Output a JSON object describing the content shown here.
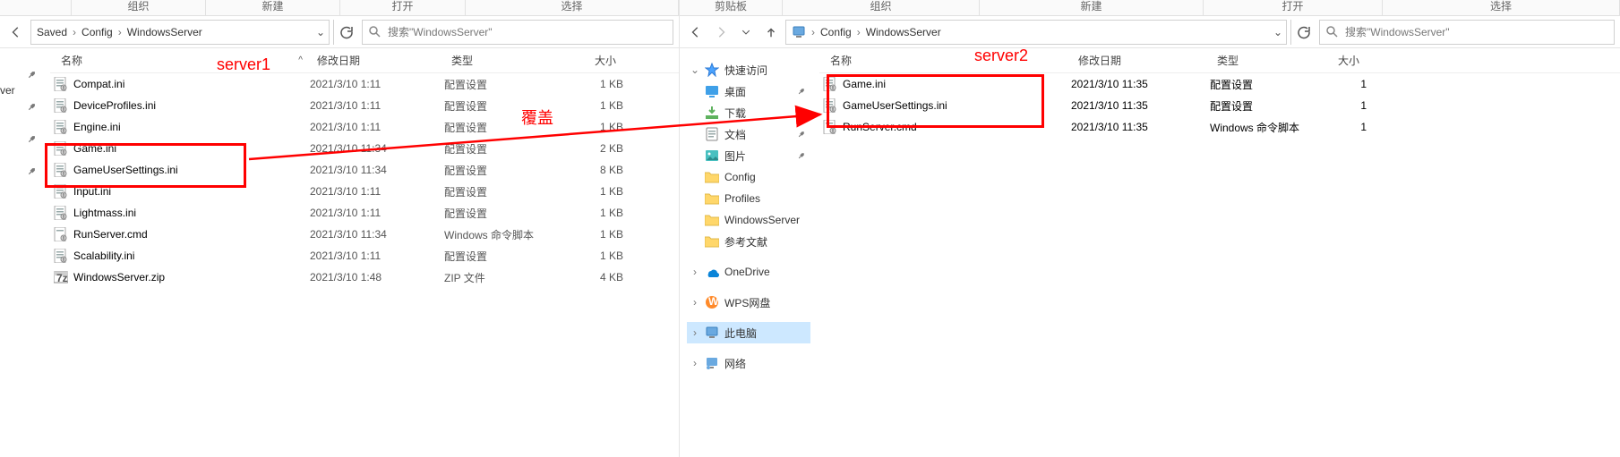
{
  "ribbon": {
    "org": "组织",
    "new": "新建",
    "open": "打开",
    "select": "选择",
    "clipboard": "剪贴板"
  },
  "left": {
    "breadcrumb": [
      "Saved",
      "Config",
      "WindowsServer"
    ],
    "search_placeholder": "搜索\"WindowsServer\"",
    "truncated_label": "ver",
    "columns": {
      "name": "名称",
      "date": "修改日期",
      "type": "类型",
      "size": "大小"
    },
    "files": [
      {
        "ico": "ini",
        "name": "Compat.ini",
        "date": "2021/3/10 1:11",
        "type": "配置设置",
        "size": "1 KB"
      },
      {
        "ico": "ini",
        "name": "DeviceProfiles.ini",
        "date": "2021/3/10 1:11",
        "type": "配置设置",
        "size": "1 KB"
      },
      {
        "ico": "ini",
        "name": "Engine.ini",
        "date": "2021/3/10 1:11",
        "type": "配置设置",
        "size": "1 KB"
      },
      {
        "ico": "ini",
        "name": "Game.ini",
        "date": "2021/3/10 11:34",
        "type": "配置设置",
        "size": "2 KB"
      },
      {
        "ico": "ini",
        "name": "GameUserSettings.ini",
        "date": "2021/3/10 11:34",
        "type": "配置设置",
        "size": "8 KB"
      },
      {
        "ico": "ini",
        "name": "Input.ini",
        "date": "2021/3/10 1:11",
        "type": "配置设置",
        "size": "1 KB"
      },
      {
        "ico": "ini",
        "name": "Lightmass.ini",
        "date": "2021/3/10 1:11",
        "type": "配置设置",
        "size": "1 KB"
      },
      {
        "ico": "cmd",
        "name": "RunServer.cmd",
        "date": "2021/3/10 11:34",
        "type": "Windows 命令脚本",
        "size": "1 KB"
      },
      {
        "ico": "ini",
        "name": "Scalability.ini",
        "date": "2021/3/10 1:11",
        "type": "配置设置",
        "size": "1 KB"
      },
      {
        "ico": "zip",
        "name": "WindowsServer.zip",
        "date": "2021/3/10 1:48",
        "type": "ZIP 文件",
        "size": "4 KB"
      }
    ]
  },
  "right": {
    "breadcrumb": [
      "Config",
      "WindowsServer"
    ],
    "search_placeholder": "搜索\"WindowsServer\"",
    "columns": {
      "name": "名称",
      "date": "修改日期",
      "type": "类型",
      "size": "大小"
    },
    "nav": {
      "quick": "快速访问",
      "desktop": "桌面",
      "downloads": "下载",
      "documents": "文档",
      "pictures": "图片",
      "config": "Config",
      "profiles": "Profiles",
      "ws": "WindowsServer",
      "ref": "参考文献",
      "onedrive": "OneDrive",
      "wps": "WPS网盘",
      "thispc": "此电脑",
      "network": "网络"
    },
    "files": [
      {
        "ico": "ini",
        "name": "Game.ini",
        "date": "2021/3/10 11:35",
        "type": "配置设置",
        "size": "1"
      },
      {
        "ico": "ini",
        "name": "GameUserSettings.ini",
        "date": "2021/3/10 11:35",
        "type": "配置设置",
        "size": "1"
      },
      {
        "ico": "cmd",
        "name": "RunServer.cmd",
        "date": "2021/3/10 11:35",
        "type": "Windows 命令脚本",
        "size": "1"
      }
    ]
  },
  "anno": {
    "server1": "server1",
    "server2": "server2",
    "overwrite": "覆盖"
  }
}
